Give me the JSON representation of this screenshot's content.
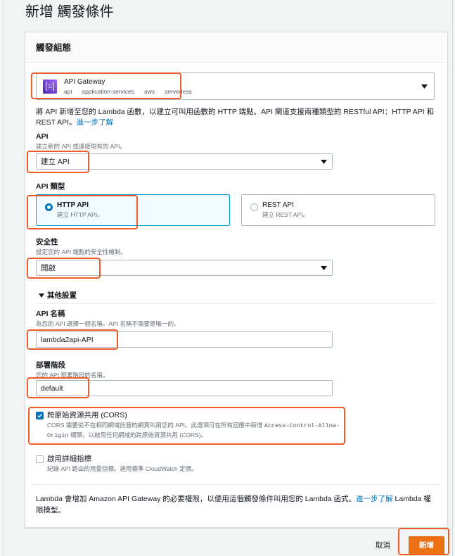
{
  "page": {
    "title": "新增 觸發條件"
  },
  "colors": {
    "accent": "#0073bb",
    "link": "#0073bb",
    "selected_tile_background": "#f1faff",
    "selected_tile_border": "#00a1c9",
    "primary_button": "#ec7211",
    "annotation_highlight": "#f15a29"
  },
  "panel": {
    "header": "觸發組態",
    "service_select": {
      "icon": "api-gateway-icon",
      "name": "API Gateway",
      "tags": [
        "api",
        "application-services",
        "aws",
        "serverless"
      ]
    },
    "description": {
      "text": "將 API 新增至您的 Lambda 函數，以建立可叫用函數的 HTTP 端點。API 閘道支援兩種類型的 RESTful API：HTTP API 和 REST API。",
      "link": "進一步了解"
    },
    "api": {
      "label": "API",
      "description": "建立新的 API 或連接現有的 API。",
      "value": "建立 API"
    },
    "api_type": {
      "label": "API 類型",
      "options": [
        {
          "title": "HTTP API",
          "description": "建立 HTTP API。",
          "selected": true
        },
        {
          "title": "REST API",
          "description": "建立 REST API。",
          "selected": false
        }
      ]
    },
    "security": {
      "label": "安全性",
      "description": "設定您的 API 端點的安全性機制。",
      "value": "開啟"
    },
    "additional_settings": {
      "toggle_label": "其他設置",
      "api_name": {
        "label": "API 名稱",
        "description": "為您的 API 選擇一個名稱。API 名稱不需要是唯一的。",
        "value": "lambda2api-API"
      },
      "stage": {
        "label": "部署階段",
        "description": "您的 API 部署階段的名稱。",
        "value": "default"
      },
      "cors": {
        "label": "跨原始資源共用 (CORS)",
        "checked": true,
        "description_before": "CORS 需要從不在相同網域託管的網頁叫用您的 API。此選項可在所有回應中新增 ",
        "description_code": "Access-Control-Allow-Origin",
        "description_after": " 標頭，以啟用任何網域的跨原始資源共用 (CORS)。"
      },
      "metrics": {
        "label": "啟用詳細指標",
        "checked": false,
        "description": "紀錄 API 路由的用量指標。適用標準 CloudWatch 定價。"
      }
    },
    "footer": {
      "text_before": "Lambda 會增加 Amazon API Gateway 的必要權限，以便用這個觸發條件叫用您的 Lambda 函式。",
      "link": "進一步了解",
      "text_after": " Lambda 權限模型。"
    }
  },
  "actions": {
    "cancel": "取消",
    "submit": "新增"
  }
}
